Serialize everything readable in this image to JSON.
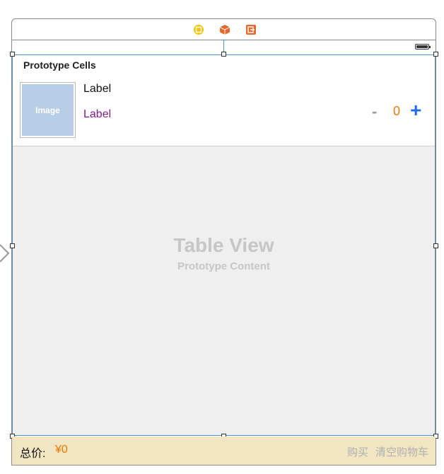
{
  "dock": {
    "icons": [
      "view-controller-icon",
      "first-responder-icon",
      "exit-icon"
    ],
    "colors": {
      "view_controller": "#f5c400",
      "first_responder": "#e8672a",
      "exit": "#e8672a"
    }
  },
  "table": {
    "prototype_title": "Prototype Cells",
    "cell": {
      "image_label": "Image",
      "label_top": "Label",
      "label_bottom": "Label",
      "minus": "-",
      "count": "0",
      "plus": "+"
    },
    "placeholder_title": "Table View",
    "placeholder_subtitle": "Prototype Content"
  },
  "bottom_bar": {
    "total_label": "总价:",
    "total_value": "¥0",
    "buy_label": "购买",
    "clear_label": "清空购物车"
  },
  "colors": {
    "selection": "#4a90c9",
    "accent_orange": "#f07800",
    "plus_blue": "#1f6fe0",
    "label_purple": "#8a1a8a",
    "bottom_bar_bg": "#f2e5c2",
    "image_placeholder": "#b8cde6"
  }
}
